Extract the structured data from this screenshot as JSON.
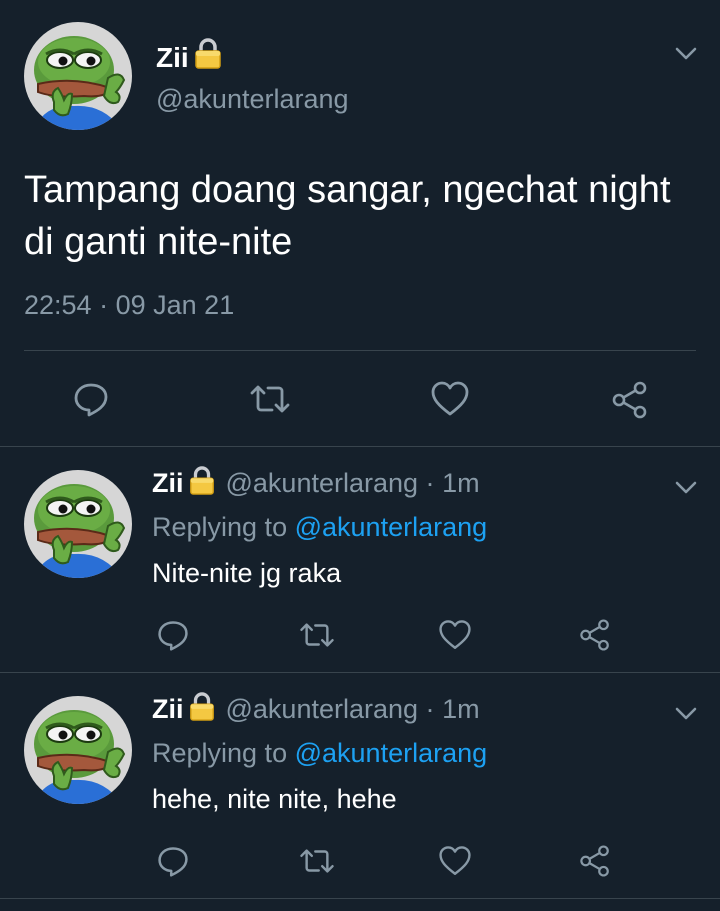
{
  "main_tweet": {
    "name": "Zii",
    "handle": "@akunterlarang",
    "text": "Tampang doang sangar, ngechat night di ganti nite-nite",
    "time": "22:54",
    "separator": "·",
    "date": "09 Jan 21"
  },
  "replies": [
    {
      "name": "Zii",
      "handle": "@akunterlarang",
      "separator": "·",
      "age": "1m",
      "replying_prefix": "Replying to",
      "replying_to": "@akunterlarang",
      "text": "Nite-nite jg raka"
    },
    {
      "name": "Zii",
      "handle": "@akunterlarang",
      "separator": "·",
      "age": "1m",
      "replying_prefix": "Replying to",
      "replying_to": "@akunterlarang",
      "text": "hehe, nite nite, hehe"
    }
  ],
  "icons": {
    "reply": "speech-bubble-icon",
    "retweet": "retweet-arrows-icon",
    "like": "heart-icon",
    "share": "share-nodes-icon",
    "menu": "chevron-down-icon",
    "protected": "lock-icon"
  },
  "colors": {
    "background": "#15202b",
    "text": "#ffffff",
    "secondary": "#8899a6",
    "accent": "#1da1f2",
    "divider": "#38444d"
  }
}
